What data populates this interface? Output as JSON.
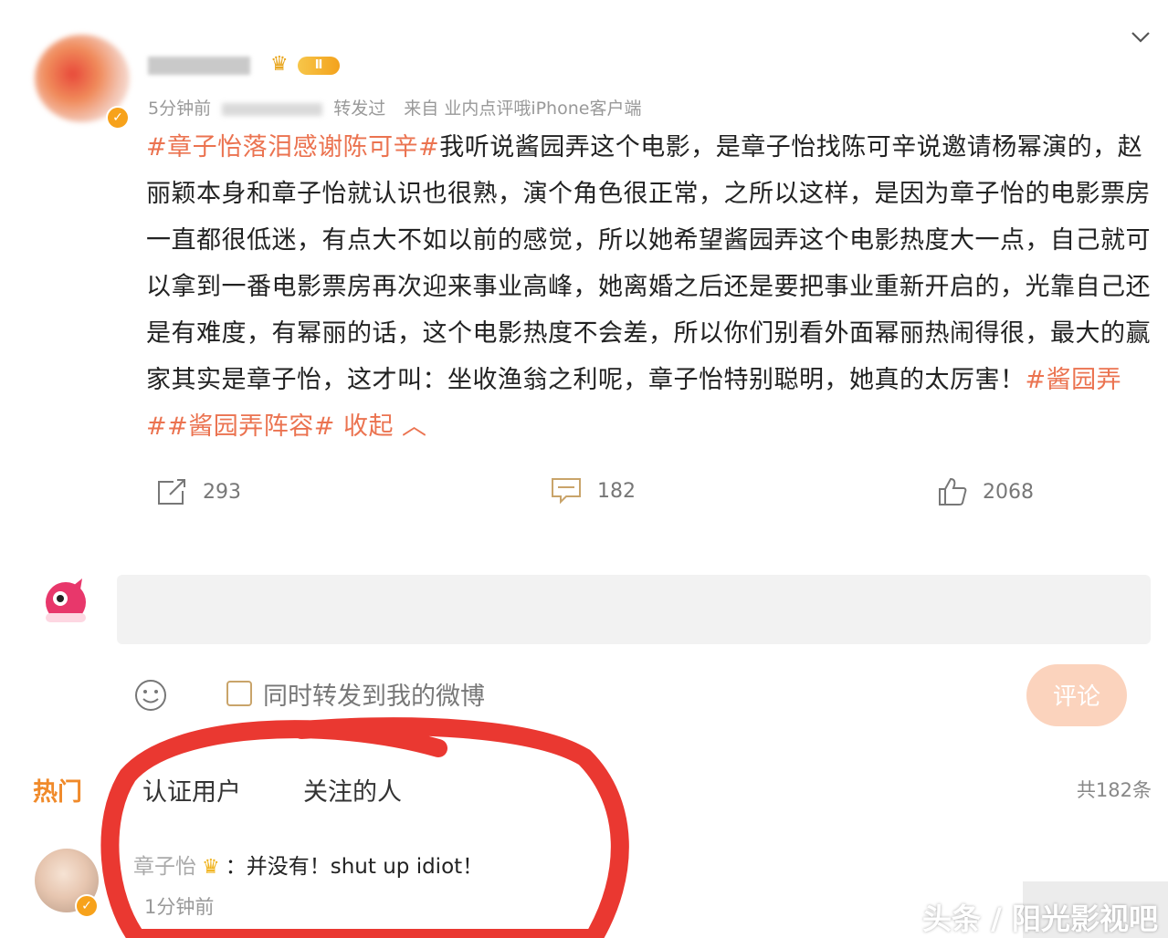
{
  "post": {
    "time": "5分钟前",
    "repost_text": "转发过",
    "source_prefix": "来自",
    "source": "业内点评哦iPhone客户端",
    "vip_label": "Ⅱ",
    "hashtag1": "#章子怡落泪感谢陈可辛#",
    "body": "我听说酱园弄这个电影，是章子怡找陈可辛说邀请杨幂演的，赵丽颖本身和章子怡就认识也很熟，演个角色很正常，之所以这样，是因为章子怡的电影票房一直都很低迷，有点大不如以前的感觉，所以她希望酱园弄这个电影热度大一点，自己就可以拿到一番电影票房再次迎来事业高峰，她离婚之后还是要把事业重新开启的，光靠自己还是有难度，有幂丽的话，这个电影热度不会差，所以你们别看外面幂丽热闹得很，最大的赢家其实是章子怡，这才叫：坐收渔翁之利呢，章子怡特别聪明，她真的太厉害！",
    "hashtag2": "#酱园弄##酱园弄阵容#",
    "collapse": "收起"
  },
  "actions": {
    "repost_count": "293",
    "comment_count": "182",
    "like_count": "2068"
  },
  "comment_box": {
    "repost_option": "同时转发到我的微博",
    "submit_label": "评论"
  },
  "tabs": {
    "hot": "热门",
    "verified": "认证用户",
    "following": "关注的人",
    "total": "共182条"
  },
  "comment": {
    "name": "章子怡",
    "text": "：并没有！shut up idiot！",
    "time": "1分钟前"
  },
  "watermark": "头条 / 阳光影视吧",
  "colors": {
    "hashtag": "#eb7350",
    "annotation": "#e8271f",
    "submit_bg": "#fbd3bd"
  }
}
